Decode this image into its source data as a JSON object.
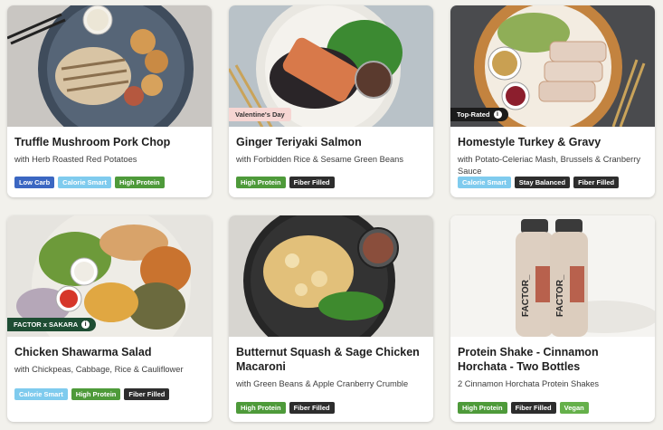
{
  "products": [
    {
      "title": "Truffle Mushroom Pork Chop",
      "subtitle": "with Herb Roasted Red Potatoes",
      "badge": "",
      "image": "pork-chop-plate",
      "tags": [
        {
          "label": "Low Carb",
          "color": "#3b67c2"
        },
        {
          "label": "Calorie Smart",
          "color": "#7fcbee"
        },
        {
          "label": "High Protein",
          "color": "#4e9a3a"
        }
      ]
    },
    {
      "title": "Ginger Teriyaki Salmon",
      "subtitle": "with Forbidden Rice & Sesame Green Beans",
      "badge": "Valentine's Day",
      "image": "salmon-plate",
      "tags": [
        {
          "label": "High Protein",
          "color": "#4e9a3a"
        },
        {
          "label": "Fiber Filled",
          "color": "#2d2d2d"
        }
      ]
    },
    {
      "title": "Homestyle Turkey & Gravy",
      "subtitle": "with Potato-Celeriac Mash, Brussels & Cranberry Sauce",
      "badge": "Top-Rated",
      "image": "turkey-plate",
      "tags": [
        {
          "label": "Calorie Smart",
          "color": "#7fcbee"
        },
        {
          "label": "Stay Balanced",
          "color": "#2d2d2d"
        },
        {
          "label": "Fiber Filled",
          "color": "#2d2d2d"
        }
      ]
    },
    {
      "title": "Chicken Shawarma Salad",
      "subtitle": "with Chickpeas, Cabbage, Rice & Cauliflower",
      "badge": "FACTOR x SAKARA",
      "image": "shawarma-salad",
      "tags": [
        {
          "label": "Calorie Smart",
          "color": "#7fcbee"
        },
        {
          "label": "High Protein",
          "color": "#4e9a3a"
        },
        {
          "label": "Fiber Filled",
          "color": "#2d2d2d"
        }
      ]
    },
    {
      "title": "Butternut Squash & Sage Chicken Macaroni",
      "subtitle": "with Green Beans & Apple Cranberry Crumble",
      "badge": "",
      "image": "macaroni-plate",
      "tags": [
        {
          "label": "High Protein",
          "color": "#4e9a3a"
        },
        {
          "label": "Fiber Filled",
          "color": "#2d2d2d"
        }
      ]
    },
    {
      "title": "Protein Shake - Cinnamon Horchata - Two Bottles",
      "subtitle": "2 Cinnamon Horchata Protein Shakes",
      "badge": "",
      "image": "protein-shake-bottles",
      "bottle_label": "FACTOR_",
      "tags": [
        {
          "label": "High Protein",
          "color": "#4e9a3a"
        },
        {
          "label": "Fiber Filled",
          "color": "#2d2d2d"
        },
        {
          "label": "Vegan",
          "color": "#65b04a"
        }
      ]
    }
  ]
}
